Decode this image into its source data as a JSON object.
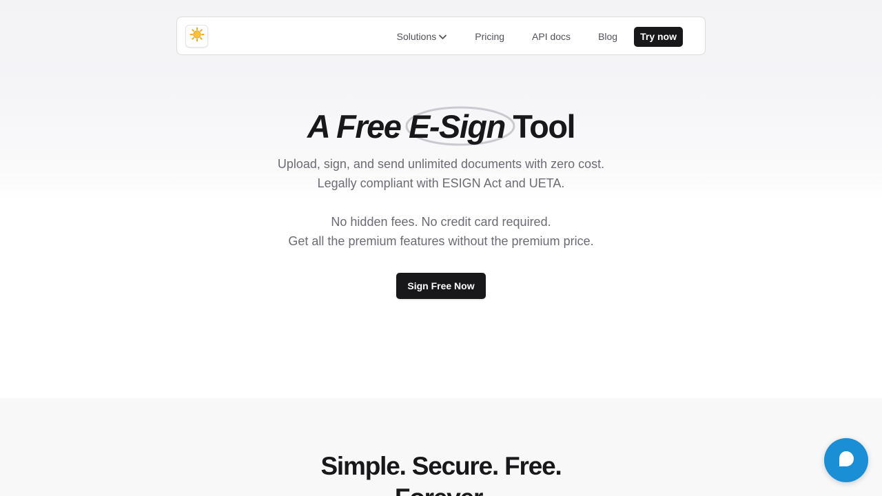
{
  "nav": {
    "logo_icon": "sun-icon",
    "links": {
      "solutions": "Solutions",
      "pricing": "Pricing",
      "api_docs": "API docs",
      "blog": "Blog"
    },
    "try_now": "Try now"
  },
  "hero": {
    "title_part1": "A Free",
    "title_highlight": "E-Sign",
    "title_part2": "Tool",
    "line1": "Upload, sign, and send unlimited documents with zero cost.",
    "line2": "Legally compliant with ESIGN Act and UETA.",
    "line3": "No hidden fees. No credit card required.",
    "line4": "Get all the premium features without the premium price.",
    "cta": "Sign Free Now"
  },
  "section2": {
    "title": "Simple. Secure. Free. Forever."
  },
  "chat": {
    "icon": "chat-bubble-icon",
    "color": "#1a8fd6"
  }
}
